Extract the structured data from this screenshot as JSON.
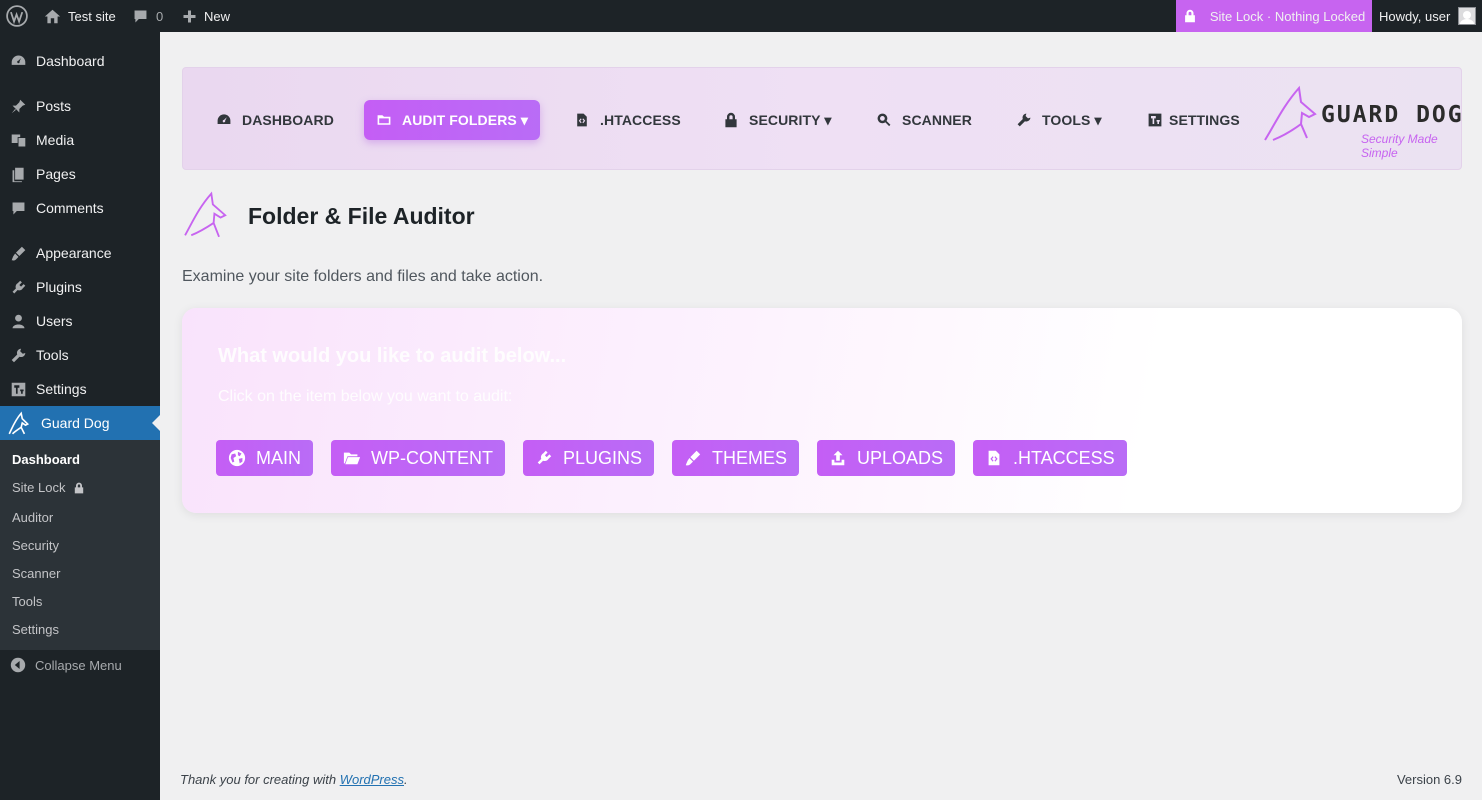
{
  "admin_bar": {
    "site_name": "Test site",
    "comments_count": "0",
    "new_label": "New",
    "site_lock_status": "Site Lock · Nothing Locked",
    "howdy": "Howdy, user"
  },
  "sidebar": {
    "items": [
      {
        "label": "Dashboard",
        "icon": "dashboard-icon"
      },
      {
        "label": "Posts",
        "icon": "pin-icon"
      },
      {
        "label": "Media",
        "icon": "media-icon"
      },
      {
        "label": "Pages",
        "icon": "pages-icon"
      },
      {
        "label": "Comments",
        "icon": "comment-icon"
      },
      {
        "label": "Appearance",
        "icon": "brush-icon"
      },
      {
        "label": "Plugins",
        "icon": "plugin-icon"
      },
      {
        "label": "Users",
        "icon": "user-icon"
      },
      {
        "label": "Tools",
        "icon": "wrench-icon"
      },
      {
        "label": "Settings",
        "icon": "settings-icon"
      },
      {
        "label": "Guard Dog",
        "icon": "guard-dog-icon"
      }
    ],
    "submenu": [
      "Dashboard",
      "Site Lock",
      "Auditor",
      "Security",
      "Scanner",
      "Tools",
      "Settings"
    ],
    "collapse_label": "Collapse Menu"
  },
  "plugin_nav": {
    "items": [
      {
        "label": "DASHBOARD",
        "icon": "gauge-icon"
      },
      {
        "label": "AUDIT FOLDERS ▾",
        "icon": "folder-icon"
      },
      {
        "label": ".HTACCESS",
        "icon": "code-file-icon"
      },
      {
        "label": "SECURITY ▾",
        "icon": "lock-icon"
      },
      {
        "label": "SCANNER",
        "icon": "search-icon"
      },
      {
        "label": "TOOLS ▾",
        "icon": "wrench-icon"
      },
      {
        "label": "SETTINGS",
        "icon": "settings-icon"
      }
    ],
    "logo_brand": "GUARD DOG",
    "logo_tagline": "Security Made Simple"
  },
  "page": {
    "title": "Folder & File Auditor",
    "description": "Examine your site folders and files and take action."
  },
  "audit_card": {
    "title": "What would you like to audit below...",
    "subtitle": "Click on the item below you want to audit:",
    "buttons": [
      {
        "label": "MAIN",
        "icon": "globe-icon"
      },
      {
        "label": "WP-CONTENT",
        "icon": "open-folder-icon"
      },
      {
        "label": "PLUGINS",
        "icon": "plugin-icon"
      },
      {
        "label": "THEMES",
        "icon": "brush-icon"
      },
      {
        "label": "UPLOADS",
        "icon": "upload-icon"
      },
      {
        "label": ".HTACCESS",
        "icon": "code-file-icon"
      }
    ]
  },
  "footer": {
    "thanks_prefix": "Thank you for creating with ",
    "thanks_link": "WordPress",
    "thanks_suffix": ".",
    "version": "Version 6.9"
  },
  "colors": {
    "accent": "#c764f0",
    "admin_dark": "#1d2327",
    "wp_blue": "#2271b1"
  }
}
